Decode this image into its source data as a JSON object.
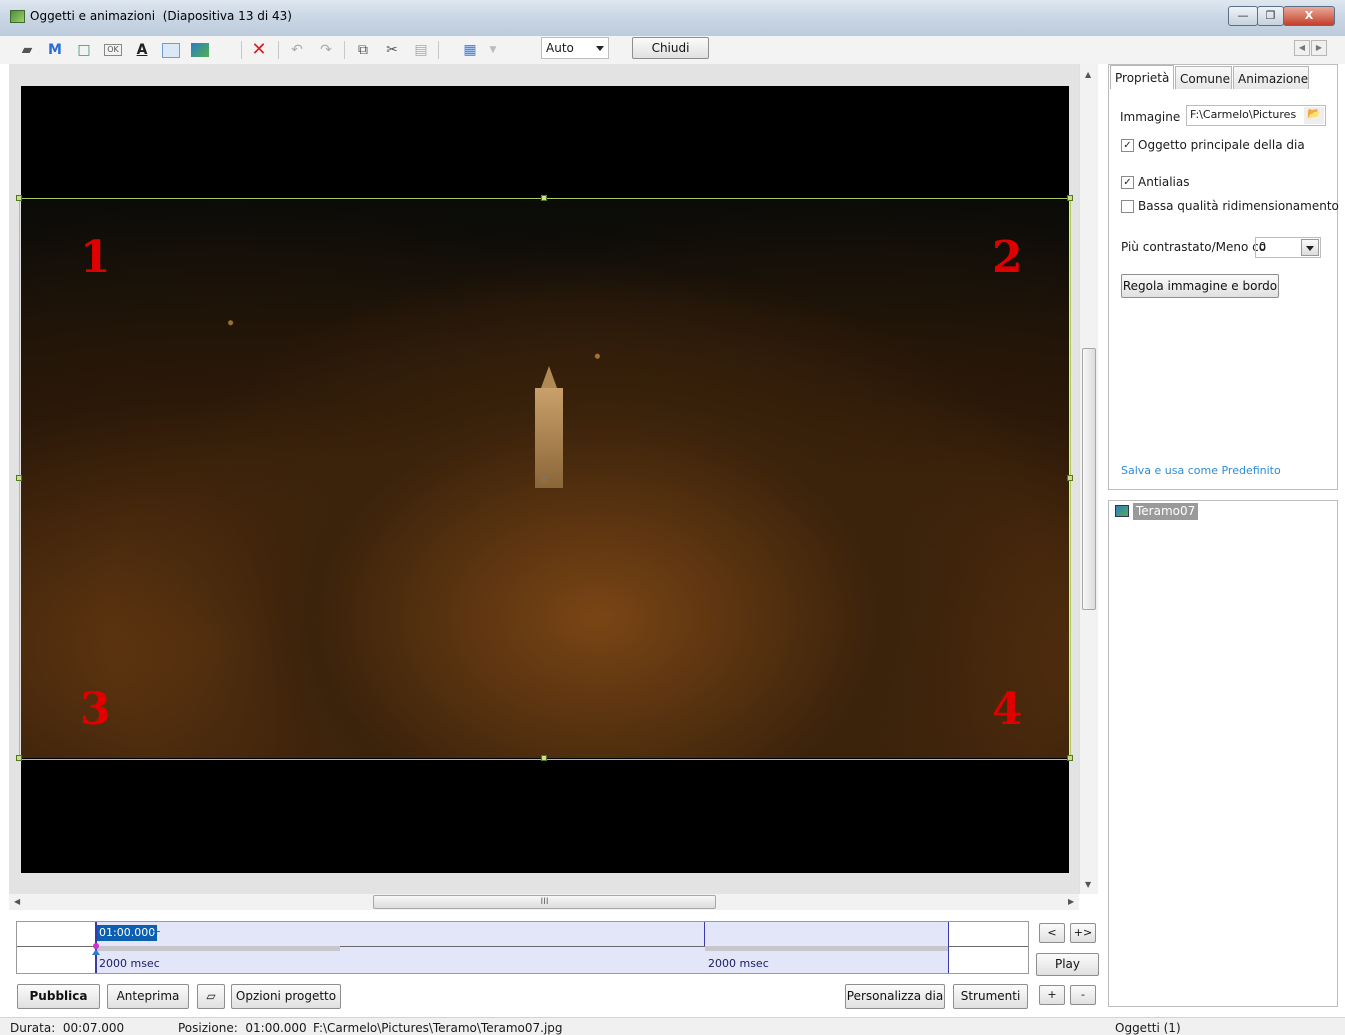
{
  "window": {
    "title": "Oggetti e animazioni",
    "subtitle": "(Diapositiva 13 di 43)",
    "controls": [
      "—",
      "❐",
      "X"
    ]
  },
  "toolbar": {
    "icons": [
      "camera-icon",
      "m-text-icon",
      "frame-icon",
      "ok-button-icon",
      "text-a-icon",
      "rectangle-icon",
      "image-icon",
      "delete-icon",
      "undo-icon",
      "redo-icon",
      "copy-icon",
      "cut-icon",
      "paste-icon",
      "grid-icon"
    ],
    "zoom_value": "Auto",
    "close_label": "Chiudi"
  },
  "canvas": {
    "corner_labels": [
      "1",
      "2",
      "3",
      "4"
    ],
    "hscroll_grip": "III"
  },
  "properties_panel": {
    "tabs": [
      "Proprietà",
      "Comune",
      "Animazione"
    ],
    "active_tab": "Proprietà",
    "image_label": "Immagine",
    "image_path": "F:\\Carmelo\\Pictures",
    "checkboxes": [
      {
        "label": "Oggetto principale della dia",
        "checked": true
      },
      {
        "label": "Antialias",
        "checked": true
      },
      {
        "label": "Bassa qualità ridimensionamento",
        "checked": false
      }
    ],
    "contrast_label": "Più contrastato/Meno co",
    "contrast_value": "0",
    "adjust_button": "Regola immagine e bordo",
    "save_default_link": "Salva e usa come Predefinito"
  },
  "objects_panel": {
    "items": [
      "Teramo07"
    ]
  },
  "timeline": {
    "current_time": "01:00.000",
    "plus": "+",
    "segments": [
      "2000 msec",
      "2000 msec"
    ]
  },
  "timeline_controls": {
    "prev": "<",
    "expand": "+>",
    "play": "Play",
    "add": "+",
    "remove": "-"
  },
  "bottom_bar": {
    "publish": "Pubblica",
    "preview": "Anteprima",
    "project_options": "Opzioni progetto",
    "customize_slide": "Personalizza dia",
    "tools": "Strumenti"
  },
  "statusbar": {
    "duration_label": "Durata:",
    "duration_value": "00:07.000",
    "position_label": "Posizione:",
    "position_value": "01:00.000",
    "file_path": "F:\\Carmelo\\Pictures\\Teramo\\Teramo07.jpg",
    "objects_count": "Oggetti (1)"
  },
  "colors": {
    "titlebar": "#c9d6e4",
    "selection_frame": "#aacc55",
    "corner_number": "#e00000",
    "link": "#2e8bd6",
    "timeline_band": "#e3e6f8",
    "timeline_time_bg": "#0a5fb0"
  }
}
